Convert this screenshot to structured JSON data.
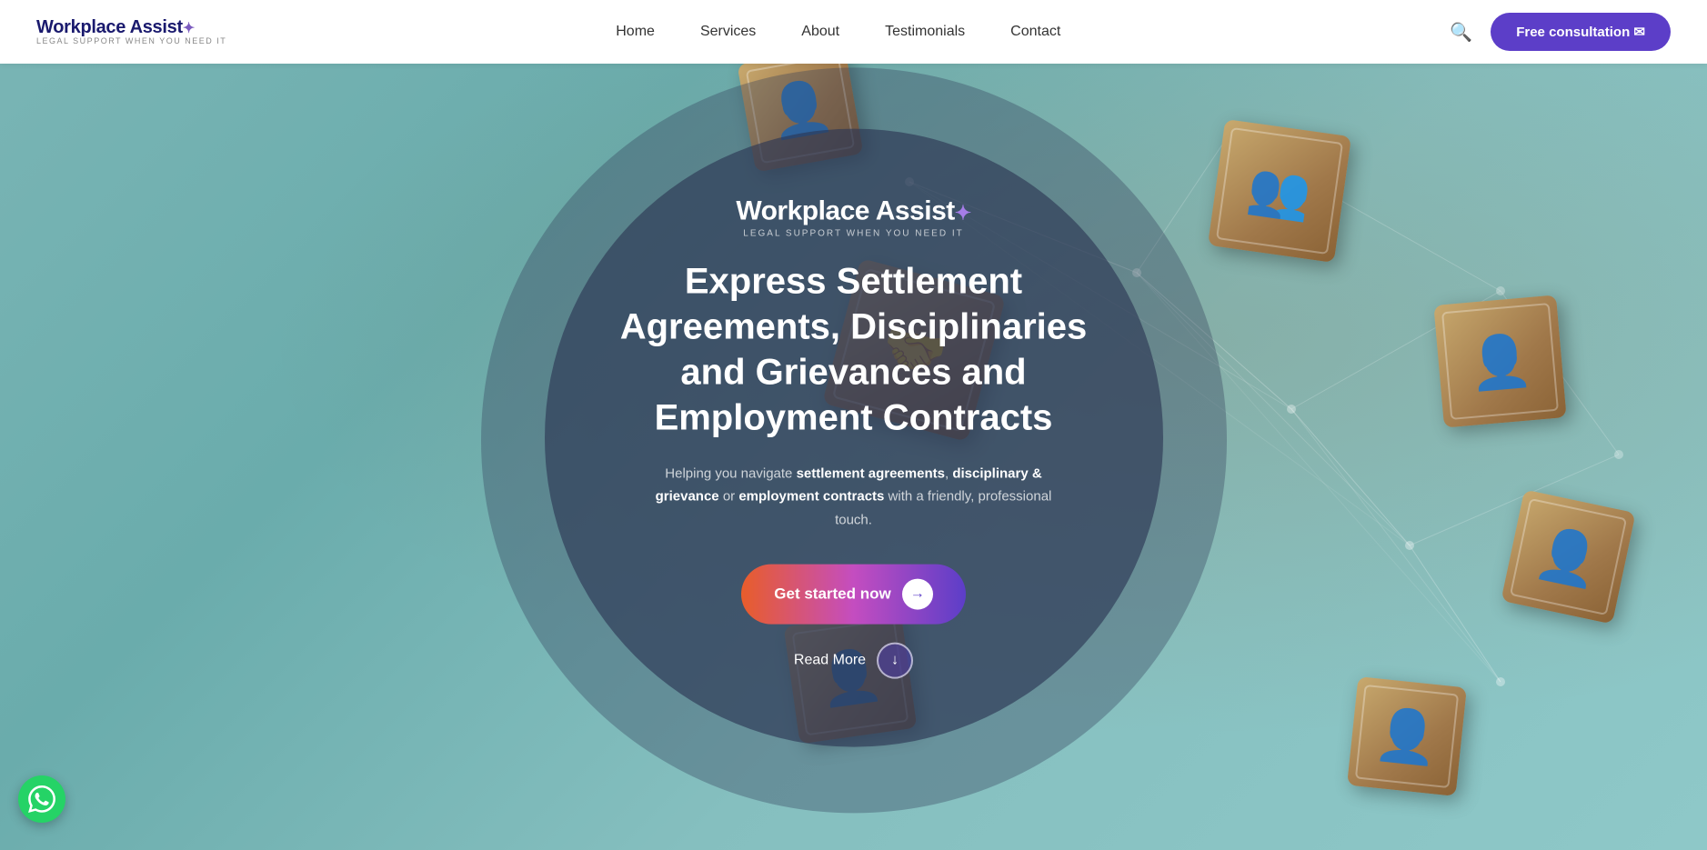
{
  "navbar": {
    "logo_main": "Workplace Assist",
    "logo_sub": "LEGAL SUPPORT WHEN YOU NEED IT",
    "nav_items": [
      {
        "label": "Home",
        "href": "#"
      },
      {
        "label": "Services",
        "href": "#"
      },
      {
        "label": "About",
        "href": "#"
      },
      {
        "label": "Testimonials",
        "href": "#"
      },
      {
        "label": "Contact",
        "href": "#"
      }
    ],
    "cta_button": "Free consultation ✉"
  },
  "hero": {
    "logo_text": "Workplace Assist",
    "logo_sub": "LEGAL SUPPORT WHEN YOU NEED IT",
    "title": "Express Settlement Agreements, Disciplinaries and Grievances and Employment Contracts",
    "subtitle_normal": "Helping you navigate ",
    "subtitle_bold1": "settlement agreements",
    "subtitle_mid": ", ",
    "subtitle_bold2": "disciplinary & grievance",
    "subtitle_or": " or ",
    "subtitle_bold3": "employment contracts",
    "subtitle_end": " with a friendly, professional touch.",
    "cta_label": "Get started now",
    "read_more_label": "Read More"
  }
}
